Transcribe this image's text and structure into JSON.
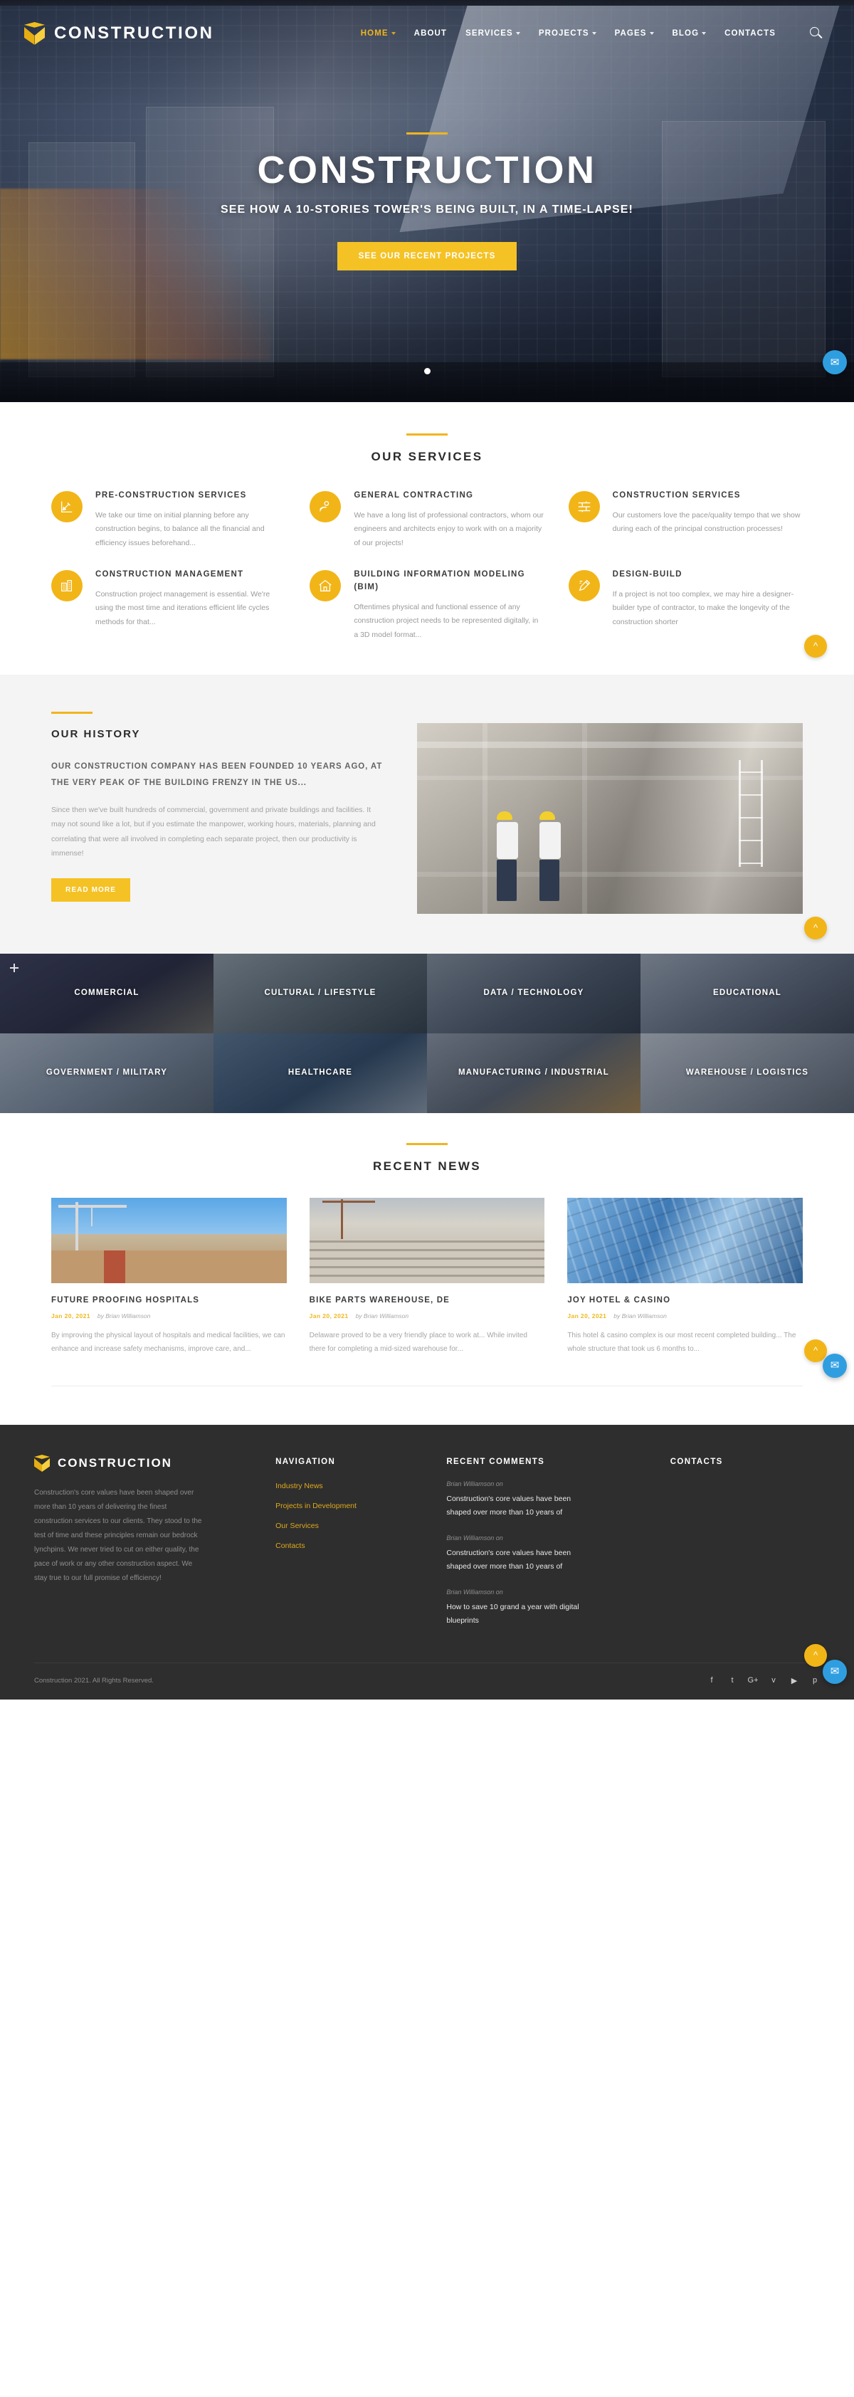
{
  "header": {
    "brand": "CONSTRUCTION",
    "logo_icon": "cube-icon",
    "search_icon": "search-icon",
    "nav": [
      {
        "label": "HOME",
        "has_dropdown": true,
        "active": true
      },
      {
        "label": "ABOUT",
        "has_dropdown": false,
        "active": false
      },
      {
        "label": "SERVICES",
        "has_dropdown": true,
        "active": false
      },
      {
        "label": "PROJECTS",
        "has_dropdown": true,
        "active": false
      },
      {
        "label": "PAGES",
        "has_dropdown": true,
        "active": false
      },
      {
        "label": "BLOG",
        "has_dropdown": true,
        "active": false
      },
      {
        "label": "CONTACTS",
        "has_dropdown": false,
        "active": false
      }
    ]
  },
  "hero": {
    "title": "CONSTRUCTION",
    "subtitle": "SEE HOW A 10-STORIES TOWER'S BEING BUILT, IN A TIME-LAPSE!",
    "cta": "SEE OUR RECENT PROJECTS",
    "slides": 1,
    "active_slide": 1
  },
  "services": {
    "title": "OUR SERVICES",
    "items": [
      {
        "icon": "blueprint-pencil-icon",
        "title": "PRE-CONSTRUCTION SERVICES",
        "text": "We take our time on initial planning before any construction begins, to balance all the financial and efficiency issues beforehand..."
      },
      {
        "icon": "handshake-worker-icon",
        "title": "GENERAL CONTRACTING",
        "text": "We have a long list of professional contractors, whom our engineers and architects enjoy to work with on a majority of our projects!"
      },
      {
        "icon": "brick-wall-icon",
        "title": "CONSTRUCTION SERVICES",
        "text": "Our customers love the pace/quality tempo that we show during each of the principal construction processes!"
      },
      {
        "icon": "office-buildings-icon",
        "title": "CONSTRUCTION MANAGEMENT",
        "text": "Construction project management is essential. We're using the most time and iterations efficient life cycles methods for that..."
      },
      {
        "icon": "house-icon",
        "title": "BUILDING INFORMATION MODELING (BIM)",
        "text": "Oftentimes physical and functional essence of any construction project needs to be represented digitally, in a 3D model format..."
      },
      {
        "icon": "pencil-draft-icon",
        "title": "DESIGN-BUILD",
        "text": "If a project is not too complex, we may hire a designer-builder type of contractor, to make the longevity of the construction shorter"
      }
    ]
  },
  "history": {
    "title": "OUR HISTORY",
    "lead": "OUR CONSTRUCTION COMPANY HAS BEEN FOUNDED 10 YEARS AGO, AT THE VERY PEAK OF THE BUILDING FRENZY IN THE US...",
    "body": "Since then we've built hundreds of commercial, government and private buildings and facilities. It may not sound like a lot, but if you estimate the manpower, working hours, materials, planning and correlating that were all involved in completing each separate project, then our productivity is immense!",
    "cta": "READ MORE",
    "image_alt": "two-engineers-on-construction-site"
  },
  "categories": [
    {
      "label": "COMMERCIAL"
    },
    {
      "label": "CULTURAL / LIFESTYLE"
    },
    {
      "label": "DATA / TECHNOLOGY"
    },
    {
      "label": "EDUCATIONAL"
    },
    {
      "label": "GOVERNMENT / MILITARY"
    },
    {
      "label": "HEALTHCARE"
    },
    {
      "label": "MANUFACTURING / INDUSTRIAL"
    },
    {
      "label": "WAREHOUSE / LOGISTICS"
    }
  ],
  "news": {
    "title": "RECENT NEWS",
    "posts": [
      {
        "title": "FUTURE PROOFING HOSPITALS",
        "date": "Jan 20, 2021",
        "author": "by Brian Williamson",
        "excerpt": "By improving the physical layout of hospitals and medical facilities, we can enhance and increase safety mechanisms, improve care, and...",
        "image_alt": "tower-crane-over-unfinished-building"
      },
      {
        "title": "BIKE PARTS WAREHOUSE, DE",
        "date": "Jan 20, 2021",
        "author": "by Brian Williamson",
        "excerpt": "Delaware proved to be a very friendly place to work at... While invited there for completing a mid-sized warehouse for...",
        "image_alt": "concrete-apartment-block-under-construction"
      },
      {
        "title": "JOY HOTEL & CASINO",
        "date": "Jan 20, 2021",
        "author": "by Brian Williamson",
        "excerpt": "This hotel & casino complex is our most recent completed building... The whole structure that took us 6 months to...",
        "image_alt": "glass-skyscraper-facade"
      }
    ]
  },
  "footer": {
    "brand": "CONSTRUCTION",
    "about": "Construction's core values have been shaped over more than 10 years of delivering the finest construction services to our clients. They stood to the test of time and these principles remain our bedrock lynchpins. We never tried to cut on either quality, the pace of work or any other construction aspect. We stay true to our full promise of efficiency!",
    "navigation": {
      "title": "NAVIGATION",
      "links": [
        "Industry News",
        "Projects in Development",
        "Our Services",
        "Contacts"
      ]
    },
    "comments": {
      "title": "RECENT COMMENTS",
      "items": [
        {
          "who": "Brian Williamson on",
          "text": "Construction's core values have been shaped over more than 10 years of"
        },
        {
          "who": "Brian Williamson on",
          "text": "Construction's core values have been shaped over more than 10 years of"
        },
        {
          "who": "Brian Williamson on",
          "text": "How to save 10 grand a year with digital blueprints"
        }
      ]
    },
    "contacts": {
      "title": "CONTACTS"
    },
    "copyright": "Construction 2021. All Rights Reserved.",
    "socials": [
      {
        "name": "facebook-icon",
        "glyph": "f"
      },
      {
        "name": "twitter-icon",
        "glyph": "t"
      },
      {
        "name": "google-plus-icon",
        "glyph": "G+"
      },
      {
        "name": "vimeo-icon",
        "glyph": "v"
      },
      {
        "name": "youtube-icon",
        "glyph": "▶"
      },
      {
        "name": "pinterest-icon",
        "glyph": "p"
      }
    ]
  },
  "widgets": {
    "chat_icon": "chat-bubble-icon",
    "scroll_top_icon": "chevron-up-icon"
  },
  "colors": {
    "accent": "#f2b518",
    "accent_bright": "#f5c225",
    "dark": "#2e2e2e",
    "hero_overlay": "#1e2637",
    "muted_text": "#9a9a9a"
  }
}
